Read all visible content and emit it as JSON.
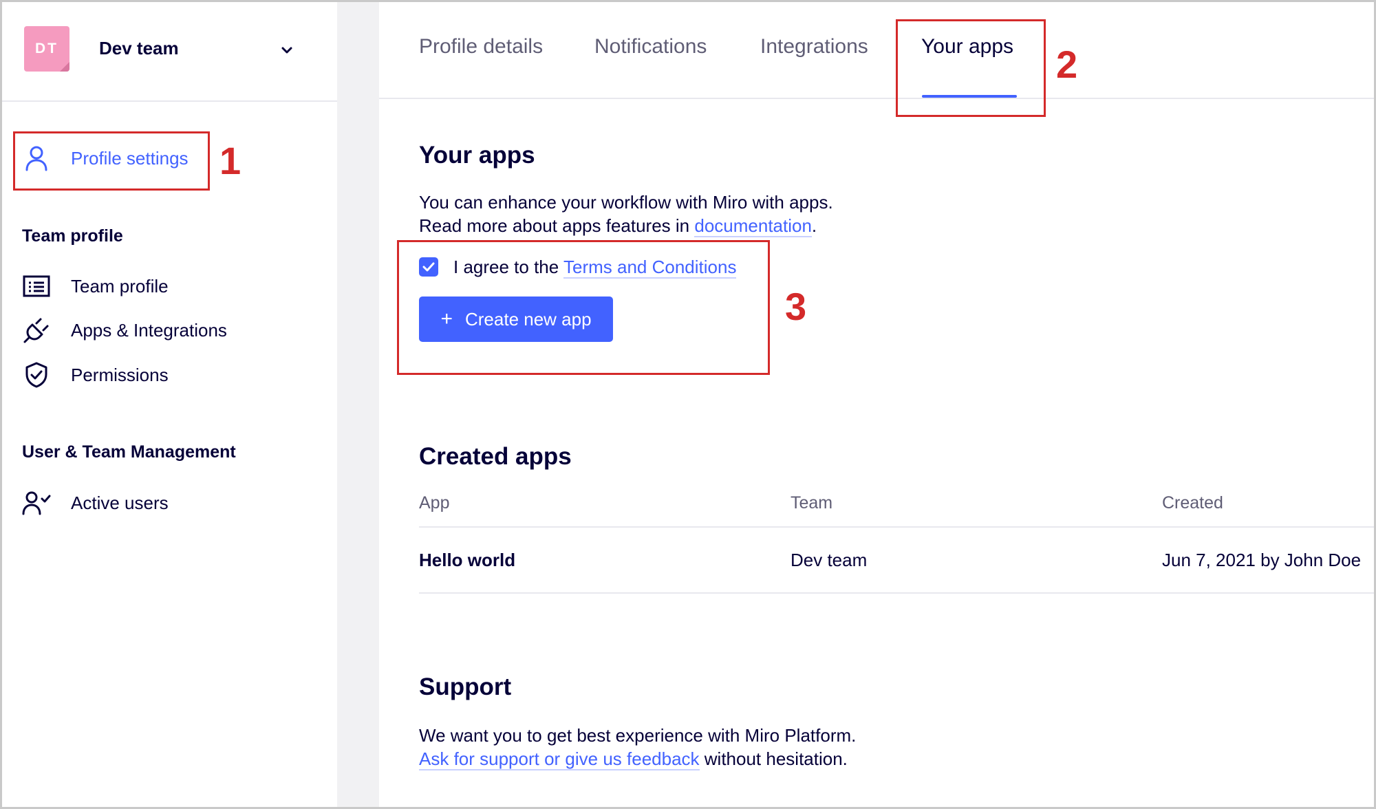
{
  "team": {
    "initials": "DT",
    "name": "Dev team"
  },
  "sidebar": {
    "profile_settings": "Profile settings",
    "team_profile_section": "Team profile",
    "items": [
      {
        "label": "Team profile"
      },
      {
        "label": "Apps & Integrations"
      },
      {
        "label": "Permissions"
      }
    ],
    "user_mgmt_section": "User & Team Management",
    "active_users": "Active users"
  },
  "tabs": [
    {
      "label": "Profile details"
    },
    {
      "label": "Notifications"
    },
    {
      "label": "Integrations"
    },
    {
      "label": "Your apps"
    }
  ],
  "your_apps": {
    "title": "Your apps",
    "line1": "You can enhance your workflow with Miro with apps.",
    "line2_prefix": "Read more about apps features in ",
    "line2_link": "documentation",
    "line2_suffix": ".",
    "agree_prefix": "I agree to the ",
    "agree_link": "Terms and Conditions",
    "agree_checked": true,
    "create_button": "Create new app",
    "create_plus": "+"
  },
  "created_apps": {
    "title": "Created apps",
    "columns": [
      "App",
      "Team",
      "Created"
    ],
    "rows": [
      {
        "app": "Hello world",
        "team": "Dev team",
        "created": "Jun 7, 2021 by John Doe"
      }
    ]
  },
  "support": {
    "title": "Support",
    "line1": "We want you to get best experience with Miro Platform.",
    "link": "Ask for support or give us feedback",
    "suffix": " without hesitation."
  },
  "annotations": [
    "1",
    "2",
    "3"
  ],
  "colors": {
    "accent": "#4262ff",
    "annotation": "#d42a2a",
    "avatar": "#f59bbf",
    "text": "#050038"
  }
}
